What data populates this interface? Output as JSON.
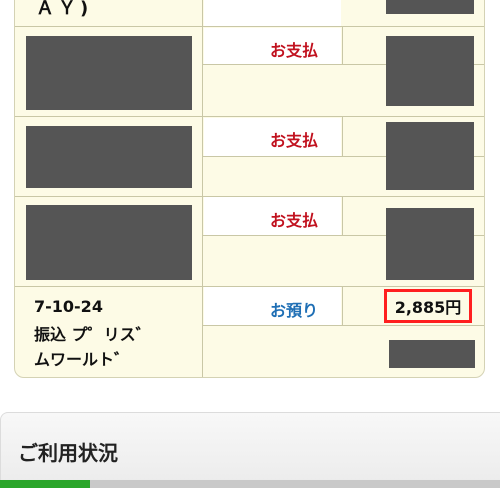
{
  "transactions": {
    "partial_top_text": "ＡＹ)",
    "rows": [
      {
        "type_label": "お支払",
        "type_kind": "withdraw"
      },
      {
        "type_label": "お支払",
        "type_kind": "withdraw"
      },
      {
        "type_label": "お支払",
        "type_kind": "withdraw"
      },
      {
        "date": "7-10-24",
        "desc_line1": "振込 プ゜リス゛",
        "desc_line2": "ムワールト゛",
        "type_label": "お預り",
        "type_kind": "deposit",
        "amount": "2,885円"
      }
    ]
  },
  "usage_section": {
    "title": "ご利用状況",
    "progress": 0.18
  },
  "colors": {
    "withdraw": "#c1121f",
    "deposit": "#1f6fb5",
    "highlight": "#ff1f1f",
    "progress": "#2aa52a"
  }
}
